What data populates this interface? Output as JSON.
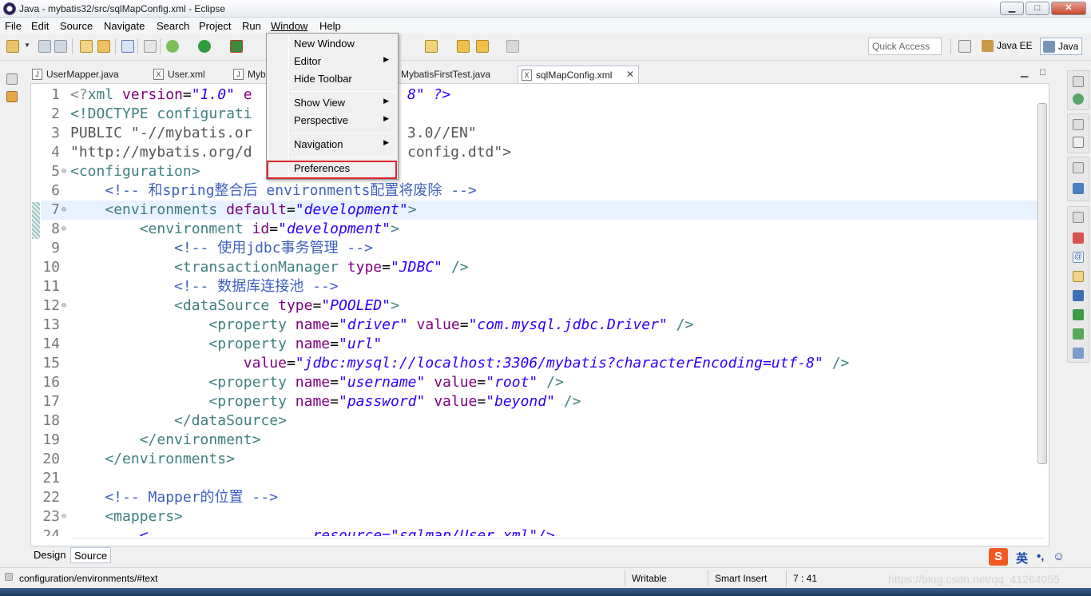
{
  "window": {
    "title": "Java - mybatis32/src/sqlMapConfig.xml - Eclipse",
    "min": "▁",
    "max": "□",
    "close": "✕"
  },
  "menubar": {
    "file": "File",
    "edit": "Edit",
    "source": "Source",
    "navigate": "Navigate",
    "search": "Search",
    "project": "Project",
    "run": "Run",
    "window": "Window",
    "help": "Help"
  },
  "window_menu": {
    "items": [
      "New Window",
      "Editor",
      "Hide Toolbar",
      "Show View",
      "Perspective",
      "Navigation",
      "Preferences"
    ],
    "submenu_arrow": "▶"
  },
  "toolbar": {
    "quick_access": "Quick Access",
    "perspective_javaee": "Java EE",
    "perspective_java": "Java"
  },
  "tabs": [
    {
      "label": "UserMapper.java",
      "icon": "J"
    },
    {
      "label": "User.xml",
      "icon": "X"
    },
    {
      "label": "Myb",
      "icon": "J"
    },
    {
      "label": "MybatisFirstTest.java",
      "icon": "J"
    },
    {
      "label": "sqlMapConfig.xml",
      "icon": "X",
      "close": "✕"
    }
  ],
  "tab_controls": {
    "minimize": "▁",
    "maximize": "□"
  },
  "editor": {
    "line_numbers": [
      "1",
      "2",
      "3",
      "4",
      "5",
      "6",
      "7",
      "8",
      "9",
      "10",
      "11",
      "12",
      "13",
      "14",
      "15",
      "16",
      "17",
      "18",
      "19",
      "20",
      "21",
      "22",
      "23",
      "24"
    ],
    "code_lines": [
      "<?xml version=\"1.0\" e",
      "<!DOCTYPE configurati",
      "PUBLIC \"-//mybatis.or",
      "\"http://mybatis.org/d",
      "<configuration>",
      "    <!-- 和spring整合后 environments配置将废除 -->",
      "    <environments default=\"development\">",
      "        <environment id=\"development\">",
      "            <!-- 使用jdbc事务管理 -->",
      "            <transactionManager type=\"JDBC\" />",
      "            <!-- 数据库连接池 -->",
      "            <dataSource type=\"POOLED\">",
      "                <property name=\"driver\" value=\"com.mysql.jdbc.Driver\" />",
      "                <property name=\"url\"",
      "                    value=\"jdbc:mysql://localhost:3306/mybatis?characterEncoding=utf-8\" />",
      "                <property name=\"username\" value=\"root\" />",
      "                <property name=\"password\" value=\"beyond\" />",
      "            </dataSource>",
      "        </environment>",
      "    </environments>",
      "",
      "    <!-- Mapper的位置 -->",
      "    <mappers>",
      "        <                   resource=\"sqlmap/User.xml\"/>"
    ],
    "code_tails": {
      "line1": "8\" ?>",
      "line3": "3.0//EN\"",
      "line4": "config.dtd\">"
    }
  },
  "bottom_tabs": {
    "design": "Design",
    "source": "Source"
  },
  "status": {
    "path": "configuration/environments/#text",
    "writable": "Writable",
    "insert_mode": "Smart Insert",
    "position": "7 : 41"
  },
  "watermark": "https://blog.csdn.net/qq_41264055",
  "ime": {
    "logo": "S",
    "lang": "英",
    "punct": "•,",
    "emoji": "☺"
  }
}
